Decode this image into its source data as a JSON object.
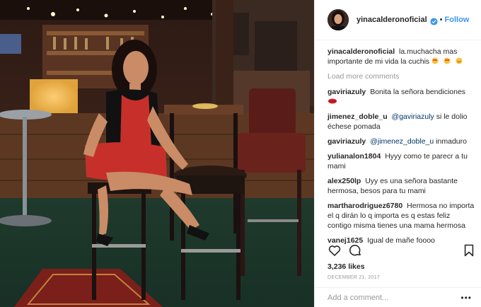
{
  "post": {
    "username": "yinacalderonoficial",
    "follow_label": "Follow",
    "caption_username": "yinacalderonoficial",
    "caption_text": "la.muchacha mas importante de mi vida la cuchis",
    "load_more_label": "Load more comments",
    "comments": [
      {
        "user": "gaviriazuly",
        "text": "Bonita la señora bendiciones"
      },
      {
        "user": "jimenez_doble_u",
        "mention": "@gaviriazuly",
        "text": "si le dolio échese pomada"
      },
      {
        "user": "gaviriazuly",
        "mention": "@jimenez_doble_u",
        "text": "inmaduro"
      },
      {
        "user": "yulianalon1804",
        "text": "Hyyy como te parecr a tu mami"
      },
      {
        "user": "alex250lp",
        "text": "Uyy es una señora bastante hermosa, besos para tu mami"
      },
      {
        "user": "martharodriguez6780",
        "text": "Hermosa no importa el q dirán lo q importa es q estas feliz contigo misma tienes una mama hermosa"
      },
      {
        "user": "vanej1625",
        "text": "Igual de mañe foooo"
      }
    ],
    "likes": "3,236 likes",
    "date": "DECEMBER 21, 2017",
    "add_comment_placeholder": "Add a comment...",
    "more_label": "•••"
  },
  "colors": {
    "link": "#3897f0",
    "text": "#262626",
    "muted": "#999999",
    "border": "#efefef",
    "verified": "#3897f0"
  },
  "icons": {
    "verified": "verified-badge-icon",
    "heart": "heart-icon",
    "comment": "comment-icon",
    "bookmark": "bookmark-icon"
  }
}
